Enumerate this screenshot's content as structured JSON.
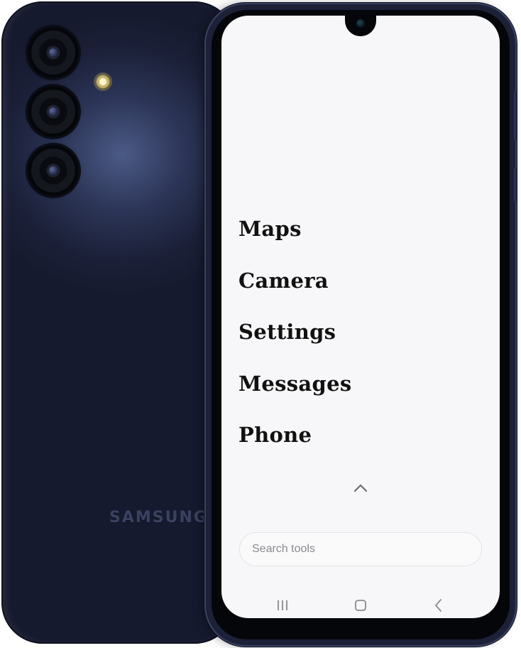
{
  "device": {
    "brand_text": "SAMSUNG"
  },
  "apps": [
    "Maps",
    "Camera",
    "Settings",
    "Messages",
    "Phone"
  ],
  "drawer": {
    "expand_icon": "chevron-up-icon"
  },
  "search": {
    "placeholder": "Search tools",
    "value": ""
  },
  "navigation": {
    "recents_icon": "recents-icon",
    "home_icon": "home-icon",
    "back_icon": "back-icon"
  },
  "colors": {
    "phone_body": "#1b2038",
    "screen_bg": "#f7f7f9",
    "text": "#111111",
    "icon": "#8a8a8f"
  }
}
